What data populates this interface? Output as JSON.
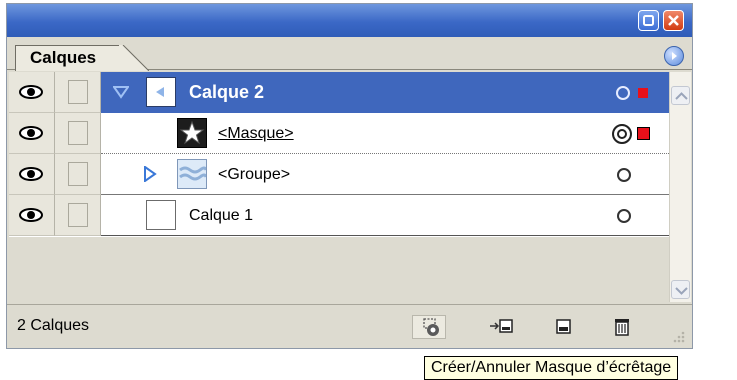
{
  "panel": {
    "tab_label": "Calques",
    "layer_count_text": "2 Calques"
  },
  "layers": [
    {
      "name": "Calque 2",
      "expanded": true,
      "selected": true,
      "icon": "layer-arrow-thumbnail"
    },
    {
      "name": "<Masque>",
      "icon": "star-mask-thumbnail"
    },
    {
      "name": "<Groupe>",
      "expanded": false,
      "icon": "group-thumbnail"
    },
    {
      "name": "Calque 1",
      "icon": "blank-thumbnail"
    }
  ],
  "bottom_tools": [
    "clipping-mask-icon",
    "new-sublayer-icon",
    "new-layer-icon",
    "trash-icon"
  ],
  "tooltip": "Créer/Annuler Masque d’écrêtage",
  "colors": {
    "selection": "#3f67bd",
    "selected_art": "#e8101a",
    "titlebar": "#3b68c6",
    "panel_bg": "#dddbd0"
  }
}
